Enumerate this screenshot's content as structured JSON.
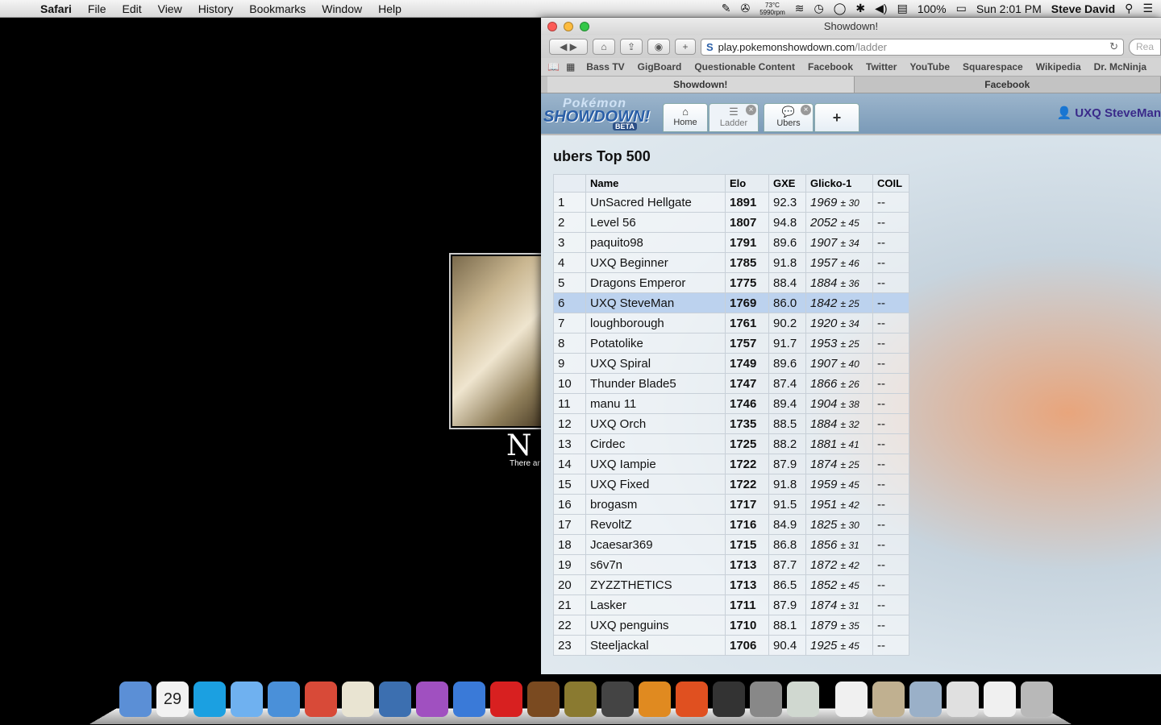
{
  "menubar": {
    "app": "Safari",
    "menus": [
      "File",
      "Edit",
      "View",
      "History",
      "Bookmarks",
      "Window",
      "Help"
    ],
    "temp": "73°C",
    "rpm": "5990rpm",
    "battery": "100%",
    "clock": "Sun 2:01 PM",
    "user": "Steve David"
  },
  "desktop": {
    "caption": "N",
    "subtext": "There ar"
  },
  "browser": {
    "title": "Showdown!",
    "url_host": "play.pokemonshowdown.com",
    "url_path": "/ladder",
    "search_placeholder": "Rea",
    "bookmarks": [
      "Bass TV",
      "GigBoard",
      "Questionable Content",
      "Facebook",
      "Twitter",
      "YouTube",
      "Squarespace",
      "Wikipedia",
      "Dr. McNinja"
    ],
    "tabs": [
      {
        "label": "Showdown!",
        "active": true
      },
      {
        "label": "Facebook",
        "active": false
      }
    ]
  },
  "showdown": {
    "logo": {
      "line1": "Pokémon",
      "line2": "SHOWDOWN!",
      "badge": "BETA"
    },
    "tabs": [
      {
        "label": "Home",
        "icon": "home-icon"
      },
      {
        "label": "Ladder",
        "icon": "list-icon"
      },
      {
        "label": "Ubers",
        "icon": "chat-icon"
      }
    ],
    "add_tab": "+",
    "username": "UXQ SteveMan",
    "ladder_title": "ubers Top 500",
    "columns": [
      "",
      "Name",
      "Elo",
      "GXE",
      "Glicko-1",
      "COIL"
    ],
    "highlight_row": 6,
    "rows": [
      {
        "rank": "1",
        "name": "UnSacred Hellgate",
        "elo": "1891",
        "gxe": "92.3",
        "glicko": "1969",
        "dev": "± 30",
        "coil": "--"
      },
      {
        "rank": "2",
        "name": "Level 56",
        "elo": "1807",
        "gxe": "94.8",
        "glicko": "2052",
        "dev": "± 45",
        "coil": "--"
      },
      {
        "rank": "3",
        "name": "paquito98",
        "elo": "1791",
        "gxe": "89.6",
        "glicko": "1907",
        "dev": "± 34",
        "coil": "--"
      },
      {
        "rank": "4",
        "name": "UXQ Beginner",
        "elo": "1785",
        "gxe": "91.8",
        "glicko": "1957",
        "dev": "± 46",
        "coil": "--"
      },
      {
        "rank": "5",
        "name": "Dragons Emperor",
        "elo": "1775",
        "gxe": "88.4",
        "glicko": "1884",
        "dev": "± 36",
        "coil": "--"
      },
      {
        "rank": "6",
        "name": "UXQ SteveMan",
        "elo": "1769",
        "gxe": "86.0",
        "glicko": "1842",
        "dev": "± 25",
        "coil": "--"
      },
      {
        "rank": "7",
        "name": "loughborough",
        "elo": "1761",
        "gxe": "90.2",
        "glicko": "1920",
        "dev": "± 34",
        "coil": "--"
      },
      {
        "rank": "8",
        "name": "Potatolike",
        "elo": "1757",
        "gxe": "91.7",
        "glicko": "1953",
        "dev": "± 25",
        "coil": "--"
      },
      {
        "rank": "9",
        "name": "UXQ Spiral",
        "elo": "1749",
        "gxe": "89.6",
        "glicko": "1907",
        "dev": "± 40",
        "coil": "--"
      },
      {
        "rank": "10",
        "name": "Thunder Blade5",
        "elo": "1747",
        "gxe": "87.4",
        "glicko": "1866",
        "dev": "± 26",
        "coil": "--"
      },
      {
        "rank": "11",
        "name": "manu 11",
        "elo": "1746",
        "gxe": "89.4",
        "glicko": "1904",
        "dev": "± 38",
        "coil": "--"
      },
      {
        "rank": "12",
        "name": "UXQ Orch",
        "elo": "1735",
        "gxe": "88.5",
        "glicko": "1884",
        "dev": "± 32",
        "coil": "--"
      },
      {
        "rank": "13",
        "name": "Cirdec",
        "elo": "1725",
        "gxe": "88.2",
        "glicko": "1881",
        "dev": "± 41",
        "coil": "--"
      },
      {
        "rank": "14",
        "name": "UXQ Iampie",
        "elo": "1722",
        "gxe": "87.9",
        "glicko": "1874",
        "dev": "± 25",
        "coil": "--"
      },
      {
        "rank": "15",
        "name": "UXQ Fixed",
        "elo": "1722",
        "gxe": "91.8",
        "glicko": "1959",
        "dev": "± 45",
        "coil": "--"
      },
      {
        "rank": "16",
        "name": "brogasm",
        "elo": "1717",
        "gxe": "91.5",
        "glicko": "1951",
        "dev": "± 42",
        "coil": "--"
      },
      {
        "rank": "17",
        "name": "RevoltZ",
        "elo": "1716",
        "gxe": "84.9",
        "glicko": "1825",
        "dev": "± 30",
        "coil": "--"
      },
      {
        "rank": "18",
        "name": "Jcaesar369",
        "elo": "1715",
        "gxe": "86.8",
        "glicko": "1856",
        "dev": "± 31",
        "coil": "--"
      },
      {
        "rank": "19",
        "name": "s6v7n",
        "elo": "1713",
        "gxe": "87.7",
        "glicko": "1872",
        "dev": "± 42",
        "coil": "--"
      },
      {
        "rank": "20",
        "name": "ZYZZTHETICS",
        "elo": "1713",
        "gxe": "86.5",
        "glicko": "1852",
        "dev": "± 45",
        "coil": "--"
      },
      {
        "rank": "21",
        "name": "Lasker",
        "elo": "1711",
        "gxe": "87.9",
        "glicko": "1874",
        "dev": "± 31",
        "coil": "--"
      },
      {
        "rank": "22",
        "name": "UXQ penguins",
        "elo": "1710",
        "gxe": "88.1",
        "glicko": "1879",
        "dev": "± 35",
        "coil": "--"
      },
      {
        "rank": "23",
        "name": "Steeljackal",
        "elo": "1706",
        "gxe": "90.4",
        "glicko": "1925",
        "dev": "± 45",
        "coil": "--"
      }
    ]
  },
  "dock": {
    "calendar_day": "29",
    "items": [
      {
        "name": "finder-icon",
        "color": "#5b8fd6"
      },
      {
        "name": "calendar-icon",
        "color": "#f2f2f2"
      },
      {
        "name": "skype-icon",
        "color": "#1ba0e1"
      },
      {
        "name": "messages-icon",
        "color": "#6fb1f0"
      },
      {
        "name": "safari-icon",
        "color": "#4a90d9"
      },
      {
        "name": "chrome-icon",
        "color": "#d84a38"
      },
      {
        "name": "textedit-icon",
        "color": "#e9e4d2"
      },
      {
        "name": "virtualbox-icon",
        "color": "#3c6fb0"
      },
      {
        "name": "itunes-icon",
        "color": "#a050c0"
      },
      {
        "name": "word-icon",
        "color": "#3a7ad8"
      },
      {
        "name": "flipboard-icon",
        "color": "#d82020"
      },
      {
        "name": "garageband-icon",
        "color": "#7a4a20"
      },
      {
        "name": "fontforge-icon",
        "color": "#8a7a30"
      },
      {
        "name": "imovie-icon",
        "color": "#444444"
      },
      {
        "name": "reason-icon",
        "color": "#e08a20"
      },
      {
        "name": "ableton-icon",
        "color": "#e05020"
      },
      {
        "name": "keyboard-icon",
        "color": "#333333"
      },
      {
        "name": "system-preferences-icon",
        "color": "#888888"
      },
      {
        "name": "preview-icon",
        "color": "#d0d8d0"
      },
      {
        "name": "pdf-document-icon",
        "color": "#f0f0f0"
      },
      {
        "name": "image-document-icon",
        "color": "#c0b090"
      },
      {
        "name": "downloads-stack-icon",
        "color": "#9ab0c8"
      },
      {
        "name": "documents-stack-icon",
        "color": "#e0e0e0"
      },
      {
        "name": "file-stack-icon",
        "color": "#f0f0f0"
      },
      {
        "name": "trash-icon",
        "color": "#b8b8b8"
      }
    ]
  }
}
